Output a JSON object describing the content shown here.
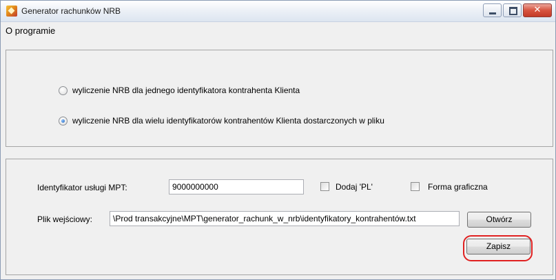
{
  "window": {
    "title": "Generator rachunków NRB",
    "app_icon": "app-logo-icon",
    "controls": {
      "minimize": "minimize-icon",
      "maximize": "maximize-icon",
      "close_glyph": "✕"
    }
  },
  "menu": {
    "items": [
      {
        "label": "O programie"
      }
    ]
  },
  "mode_group": {
    "options": [
      {
        "label": "wyliczenie NRB dla jednego identyfikatora kontrahenta Klienta",
        "checked": false
      },
      {
        "label": "wyliczenie NRB dla wielu identyfikatorów kontrahentów Klienta dostarczonych w pliku",
        "checked": true
      }
    ]
  },
  "form": {
    "service_id_label": "Identyfikator usługi MPT:",
    "service_id_value": "9000000000",
    "add_pl_label": "Dodaj 'PL'",
    "add_pl_checked": false,
    "graphic_form_label": "Forma graficzna",
    "graphic_form_checked": false,
    "input_file_label": "Plik wejściowy:",
    "input_file_value": "\\Prod transakcyjne\\MPT\\generator_rachunk_w_nrb\\identyfikatory_kontrahentów.txt",
    "open_button": "Otwórz",
    "save_button": "Zapisz",
    "highlight_color": "#e02020"
  }
}
